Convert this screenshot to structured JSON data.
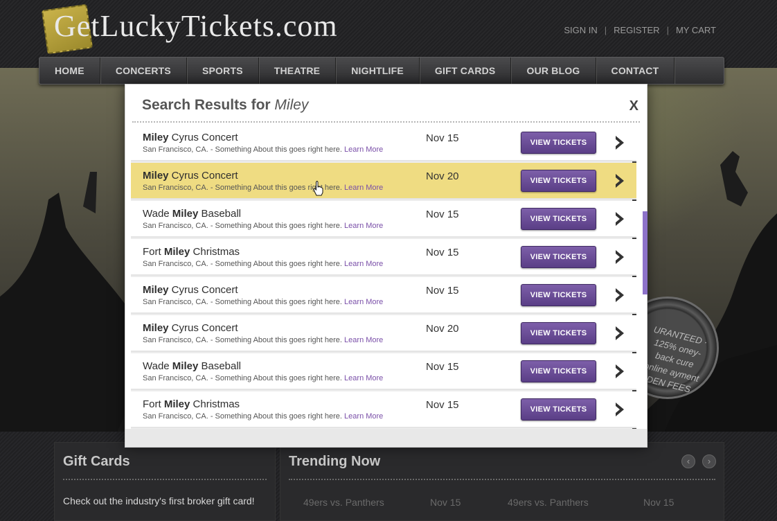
{
  "site": {
    "logo_text": "GetLuckyTickets.com",
    "logo_initial": "G",
    "logo_lucky": "L"
  },
  "toplinks": {
    "sign_in": "SIGN IN",
    "register": "REGISTER",
    "my_cart": "MY CART",
    "separator": "|"
  },
  "nav": [
    {
      "label": "HOME"
    },
    {
      "label": "CONCERTS"
    },
    {
      "label": "SPORTS"
    },
    {
      "label": "THEATRE"
    },
    {
      "label": "NIGHTLIFE"
    },
    {
      "label": "GIFT CARDS"
    },
    {
      "label": "OUR BLOG"
    },
    {
      "label": "CONTACT"
    }
  ],
  "badge": {
    "text": "URANTEED · 125% oney-back cure online ayment DEN FEES"
  },
  "modal": {
    "title_prefix": "Search Results for",
    "query": "Miley",
    "close": "X",
    "button_label": "VIEW TICKETS",
    "learn_more": "Learn More",
    "results": [
      {
        "pre": "",
        "bold": "Miley",
        "post": " Cyrus Concert",
        "desc": "San Francisco, CA. -  Something About this goes right here.",
        "date": "Nov 15",
        "highlighted": false
      },
      {
        "pre": "",
        "bold": "Miley",
        "post": " Cyrus Concert",
        "desc": "San Francisco, CA. -  Something About this goes right here.",
        "date": "Nov 20",
        "highlighted": true
      },
      {
        "pre": "Wade ",
        "bold": "Miley",
        "post": " Baseball",
        "desc": "San Francisco, CA. -  Something About this goes right here.",
        "date": "Nov 15",
        "highlighted": false
      },
      {
        "pre": "Fort ",
        "bold": "Miley",
        "post": " Christmas",
        "desc": "San Francisco, CA. -  Something About this goes right here.",
        "date": "Nov 15",
        "highlighted": false
      },
      {
        "pre": "",
        "bold": "Miley",
        "post": " Cyrus Concert",
        "desc": "San Francisco, CA. -  Something About this goes right here.",
        "date": "Nov 15",
        "highlighted": false
      },
      {
        "pre": "",
        "bold": "Miley",
        "post": " Cyrus Concert",
        "desc": "San Francisco, CA. -  Something About this goes right here.",
        "date": "Nov 20",
        "highlighted": false
      },
      {
        "pre": "Wade ",
        "bold": "Miley",
        "post": " Baseball",
        "desc": "San Francisco, CA. -  Something About this goes right here.",
        "date": "Nov 15",
        "highlighted": false
      },
      {
        "pre": "Fort ",
        "bold": "Miley",
        "post": " Christmas",
        "desc": "San Francisco, CA. -  Something About this goes right here.",
        "date": "Nov 15",
        "highlighted": false
      }
    ]
  },
  "gift_cards": {
    "title": "Gift Cards",
    "text": "Check out the industry's first broker gift card!"
  },
  "trending": {
    "title": "Trending Now",
    "prev": "‹",
    "next": "›",
    "items": [
      {
        "event": "49ers vs. Panthers",
        "date": "Nov 15"
      },
      {
        "event": "49ers vs. Panthers",
        "date": "Nov 15"
      }
    ]
  },
  "colors": {
    "accent_purple": "#6b4c97",
    "highlight_row": "#efdc82",
    "link": "#7a4fa8"
  }
}
